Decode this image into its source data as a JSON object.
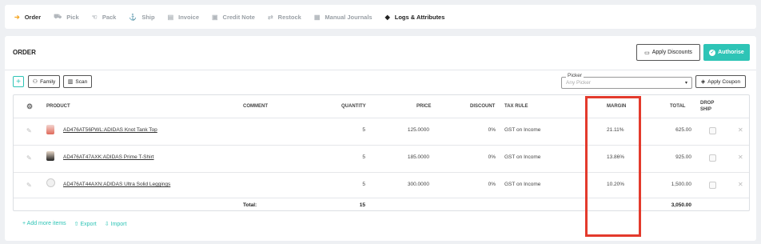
{
  "tabs": [
    {
      "label": "Order",
      "icon": "arrow-right-icon"
    },
    {
      "label": "Pick",
      "icon": "cart-icon"
    },
    {
      "label": "Pack",
      "icon": "hand-icon"
    },
    {
      "label": "Ship",
      "icon": "ship-icon"
    },
    {
      "label": "Invoice",
      "icon": "invoice-icon"
    },
    {
      "label": "Credit Note",
      "icon": "credit-note-icon"
    },
    {
      "label": "Restock",
      "icon": "restock-icon"
    },
    {
      "label": "Manual Journals",
      "icon": "journal-icon"
    },
    {
      "label": "Logs & Attributes",
      "icon": "tag-icon"
    }
  ],
  "card": {
    "title": "ORDER",
    "apply_discounts": "Apply Discounts",
    "authorise": "Authorise",
    "family": "Family",
    "scan": "Scan",
    "picker_label": "Picker",
    "picker_value": "Any Picker",
    "apply_coupon": "Apply Coupon"
  },
  "table": {
    "headers": {
      "product": "PRODUCT",
      "comment": "COMMENT",
      "quantity": "QUANTITY",
      "price": "PRICE",
      "discount": "DISCOUNT",
      "tax_rule": "TAX RULE",
      "margin": "MARGIN",
      "total": "TOTAL",
      "drop_ship_1": "DROP",
      "drop_ship_2": "SHIP"
    },
    "rows": [
      {
        "product": "AD476AT56PWL:ADIDAS Knot Tank Top",
        "quantity": "5",
        "price": "125.0000",
        "discount": "0%",
        "tax_rule": "GST on Income",
        "margin": "21.11%",
        "total": "625.00"
      },
      {
        "product": "AD476AT47AXK:ADIDAS Prime T-Shirt",
        "quantity": "5",
        "price": "185.0000",
        "discount": "0%",
        "tax_rule": "GST on Income",
        "margin": "13.86%",
        "total": "925.00"
      },
      {
        "product": "AD476AT44AXN:ADIDAS Ultra Solid Leggings",
        "quantity": "5",
        "price": "300.0000",
        "discount": "0%",
        "tax_rule": "GST on Income",
        "margin": "10.20%",
        "total": "1,500.00"
      }
    ],
    "total_label": "Total:",
    "total_quantity": "15",
    "grand_total": "3,050.00"
  },
  "footer": {
    "add_more": "+ Add more items",
    "export": "Export",
    "import": "Import"
  },
  "colors": {
    "accent": "#2ec4b6",
    "active_tab_icon": "#f5a623",
    "highlight": "#e33a2c"
  }
}
